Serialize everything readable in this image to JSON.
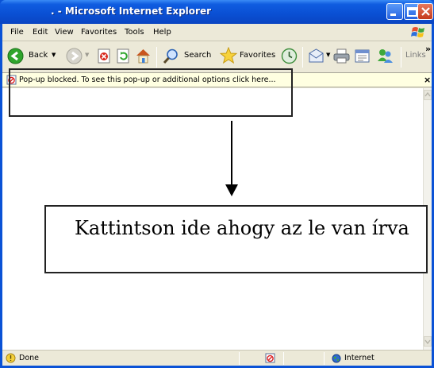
{
  "window": {
    "title": ". - Microsoft Internet Explorer"
  },
  "menu": {
    "items": [
      "File",
      "Edit",
      "View",
      "Favorites",
      "Tools",
      "Help"
    ]
  },
  "toolbar": {
    "back_label": "Back",
    "search_label": "Search",
    "favorites_label": "Favorites",
    "links_label": "Links",
    "overflow_label": "»"
  },
  "infobar": {
    "text": "Pop-up blocked. To see this pop-up or additional options click here...",
    "close_label": "×"
  },
  "annotation": {
    "instruction_text": "Kattintson ide ahogy az le van írva"
  },
  "status": {
    "left_text": "Done",
    "zone_text": "Internet"
  },
  "colors": {
    "titlebar": "#0a4fd3",
    "infobar_bg": "#ffffe1",
    "chrome_bg": "#ece9d8"
  }
}
